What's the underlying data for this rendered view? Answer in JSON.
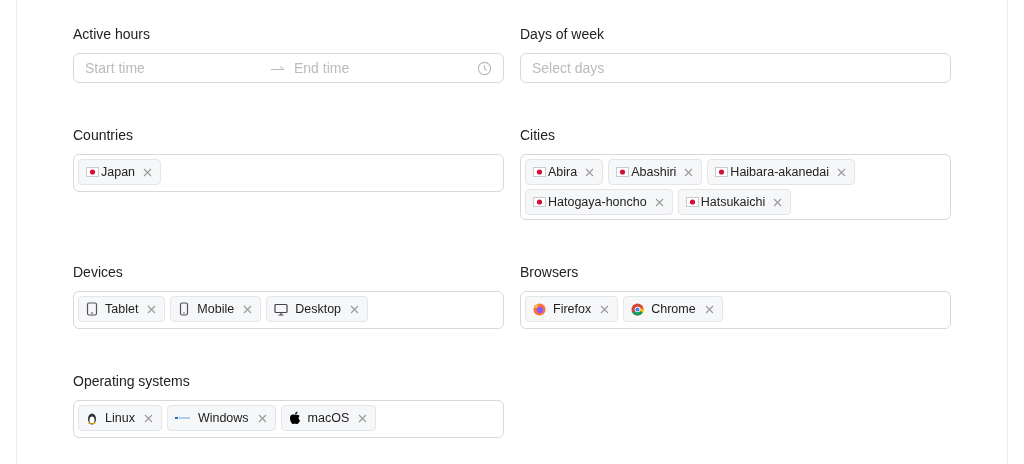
{
  "active_hours": {
    "label": "Active hours",
    "start_placeholder": "Start time",
    "end_placeholder": "End time"
  },
  "days_of_week": {
    "label": "Days of week",
    "placeholder": "Select days"
  },
  "countries": {
    "label": "Countries",
    "tags": [
      {
        "label": "Japan",
        "kind": "flag"
      }
    ]
  },
  "cities": {
    "label": "Cities",
    "tags": [
      {
        "label": "Abira",
        "kind": "flag"
      },
      {
        "label": "Abashiri",
        "kind": "flag"
      },
      {
        "label": "Haibara-akanedai",
        "kind": "flag"
      },
      {
        "label": "Hatogaya-honcho",
        "kind": "flag"
      },
      {
        "label": "Hatsukaichi",
        "kind": "flag"
      }
    ]
  },
  "devices": {
    "label": "Devices",
    "tags": [
      {
        "label": "Tablet",
        "kind": "tablet"
      },
      {
        "label": "Mobile",
        "kind": "mobile"
      },
      {
        "label": "Desktop",
        "kind": "desktop"
      }
    ]
  },
  "browsers": {
    "label": "Browsers",
    "tags": [
      {
        "label": "Firefox",
        "kind": "firefox"
      },
      {
        "label": "Chrome",
        "kind": "chrome"
      }
    ]
  },
  "operating_systems": {
    "label": "Operating systems",
    "tags": [
      {
        "label": "Linux",
        "kind": "linux"
      },
      {
        "label": "Windows",
        "kind": "windows"
      },
      {
        "label": "macOS",
        "kind": "apple"
      }
    ]
  }
}
